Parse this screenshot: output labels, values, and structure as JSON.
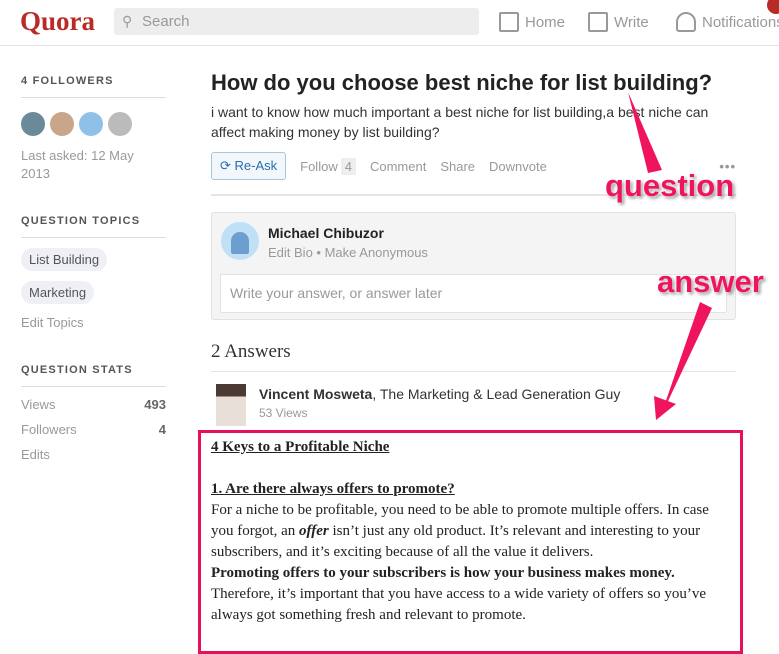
{
  "header": {
    "logo": "Quora",
    "search_placeholder": "Search",
    "nav": [
      "Home",
      "Write",
      "Notifications"
    ],
    "brand_color": "#b92b27"
  },
  "sidebar": {
    "followers_heading": "4 FOLLOWERS",
    "last_asked": "Last asked: 12 May 2013",
    "topics_heading": "QUESTION TOPICS",
    "topics": [
      "List Building",
      "Marketing"
    ],
    "edit_topics": "Edit Topics",
    "stats_heading": "QUESTION STATS",
    "stats": [
      {
        "label": "Views",
        "value": "493"
      },
      {
        "label": "Followers",
        "value": "4"
      },
      {
        "label": "Edits",
        "value": ""
      }
    ]
  },
  "question": {
    "title": "How do you choose best niche for list building?",
    "details": "i want to know how much important a best niche for list building,a best niche can affect making money by list building?",
    "reask": "Re-Ask",
    "follow": "Follow",
    "follow_count": "4",
    "comment": "Comment",
    "share": "Share",
    "downvote": "Downvote"
  },
  "composer": {
    "name": "Michael Chibuzor",
    "edit_bio": "Edit Bio",
    "make_anon": "Make Anonymous",
    "placeholder": "Write your answer, or answer later"
  },
  "answers": {
    "count": "2 Answers",
    "author": "Vincent Mosweta",
    "credential": ", The Marketing & Lead Generation Guy",
    "views": "53 Views",
    "heading": "4 Keys to a Profitable Niche",
    "sub1": "1. Are there always offers to promote?",
    "p1a": "For a niche to be profitable, you need to be able to promote multiple offers. In case you forgot, an ",
    "p1em": "offer",
    "p1b": " isn’t just any old product. It’s relevant and interesting to your subscribers, and it’s exciting because of all the value it delivers.",
    "p2b": "Promoting offers to your subscribers is how your business makes money.",
    "p2": " Therefore, it’s important that you have access to a wide variety of offers so you’ve always got something fresh and relevant to promote."
  },
  "annotations": {
    "question": "question",
    "answer": "answer",
    "color": "#f0145e"
  }
}
